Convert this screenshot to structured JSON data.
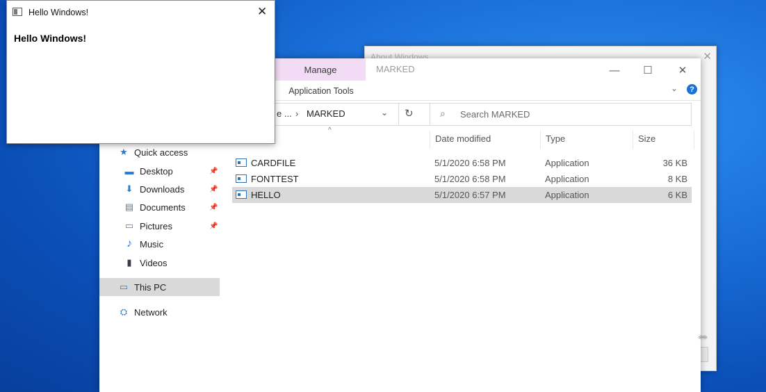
{
  "about_window": {
    "title": "About Windows",
    "close": "✕"
  },
  "explorer": {
    "ribbon": {
      "manage_tab": "Manage",
      "app_tools_tab": "Application Tools"
    },
    "title": "MARKED",
    "controls": {
      "minimize": "—",
      "maximize": "☐",
      "close": "✕"
    },
    "collapse_ribbon": "⌄",
    "help": "?",
    "address": {
      "prefix": "e ...",
      "separator": "›",
      "current": "MARKED",
      "dropdown": "⌄",
      "refresh": "↻"
    },
    "search": {
      "placeholder": "Search MARKED",
      "icon": "⌕"
    },
    "nav": [
      {
        "label": "Quick access",
        "icon": "★",
        "pinned": false
      },
      {
        "label": "Desktop",
        "icon": "▬",
        "pinned": true
      },
      {
        "label": "Downloads",
        "icon": "⬇",
        "pinned": true
      },
      {
        "label": "Documents",
        "icon": "▤",
        "pinned": true
      },
      {
        "label": "Pictures",
        "icon": "▭",
        "pinned": true
      },
      {
        "label": "Music",
        "icon": "♪",
        "pinned": false
      },
      {
        "label": "Videos",
        "icon": "▮",
        "pinned": false
      },
      {
        "label": "This PC",
        "icon": "▭",
        "pinned": false,
        "selected": true
      },
      {
        "label": "Network",
        "icon": "⛭",
        "pinned": false
      }
    ],
    "pin_glyph": "📌",
    "columns": {
      "sort_indicator": "^",
      "date": "Date modified",
      "type": "Type",
      "size": "Size"
    },
    "files": [
      {
        "name": "CARDFILE",
        "date": "5/1/2020 6:58 PM",
        "type": "Application",
        "size": "36 KB"
      },
      {
        "name": "FONTTEST",
        "date": "5/1/2020 6:58 PM",
        "type": "Application",
        "size": "8 KB"
      },
      {
        "name": "HELLO",
        "date": "5/1/2020 6:57 PM",
        "type": "Application",
        "size": "6 KB",
        "selected": true
      }
    ]
  },
  "hello_window": {
    "title": "Hello Windows!",
    "close": "✕",
    "content": "Hello Windows!"
  },
  "colors": {
    "accent_manage": "#f2dcf5",
    "selection": "#d9d9d9",
    "desktop_blue": "#1a6fd8",
    "help_blue": "#1a72d8"
  }
}
